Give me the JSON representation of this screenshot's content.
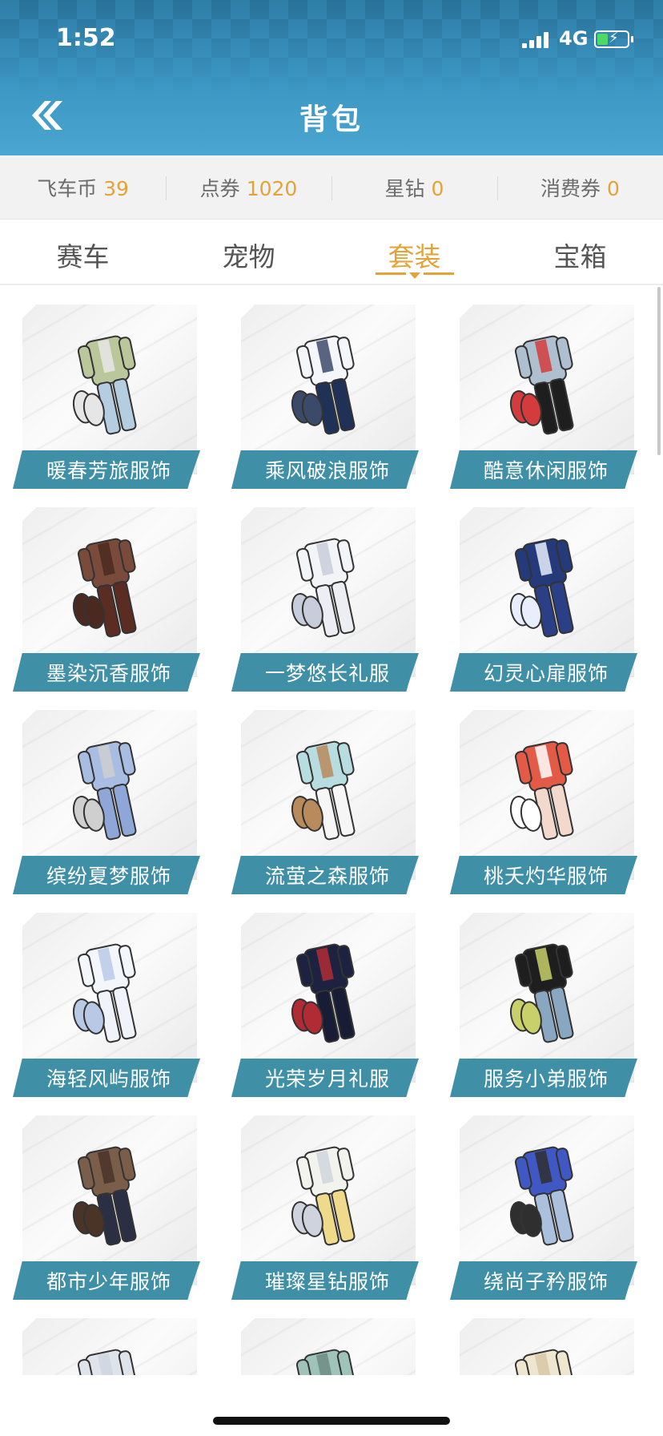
{
  "status_bar": {
    "time": "1:52",
    "network": "4G",
    "icons": [
      "cellular-signal-icon",
      "battery-charging-icon"
    ]
  },
  "header": {
    "title": "背包",
    "back_icon": "double-chevron-left-icon"
  },
  "currency": [
    {
      "label": "飞车币",
      "value": "39"
    },
    {
      "label": "点券",
      "value": "1020"
    },
    {
      "label": "星钻",
      "value": "0"
    },
    {
      "label": "消费券",
      "value": "0"
    }
  ],
  "tabs": [
    {
      "label": "赛车",
      "active": false
    },
    {
      "label": "宠物",
      "active": false
    },
    {
      "label": "套装",
      "active": true
    },
    {
      "label": "宝箱",
      "active": false
    }
  ],
  "colors": {
    "accent": "#e3a33a",
    "header": "#3c97c3",
    "label_bg": "#3f8fa6"
  },
  "items": [
    {
      "name": "暖春芳旅服饰",
      "top": "#b9c79a",
      "bottom": "#b4cde0",
      "accent": "#e6e6e6"
    },
    {
      "name": "乘风破浪服饰",
      "top": "#f4f6fa",
      "bottom": "#1f3157",
      "accent": "#3c4a6a"
    },
    {
      "name": "酷意休闲服饰",
      "top": "#aebfd0",
      "bottom": "#1e1e1e",
      "accent": "#d33c3c"
    },
    {
      "name": "墨染沉香服饰",
      "top": "#7a4a3a",
      "bottom": "#5a2c22",
      "accent": "#4a2a20"
    },
    {
      "name": "一梦悠长礼服",
      "top": "#f3f4f7",
      "bottom": "#eceef3",
      "accent": "#c7cdda"
    },
    {
      "name": "幻灵心扉服饰",
      "top": "#243a7a",
      "bottom": "#2a3f86",
      "accent": "#e8eefb"
    },
    {
      "name": "缤纷夏梦服饰",
      "top": "#a9bde3",
      "bottom": "#8ea7d8",
      "accent": "#cfcfcf"
    },
    {
      "name": "流萤之森服饰",
      "top": "#b8dde0",
      "bottom": "#f6f6f6",
      "accent": "#b98a5c"
    },
    {
      "name": "桃夭灼华服饰",
      "top": "#e35b46",
      "bottom": "#f3d8cc",
      "accent": "#ffffff"
    },
    {
      "name": "海轻风屿服饰",
      "top": "#f3f6fb",
      "bottom": "#f0f3f9",
      "accent": "#b8c9e6"
    },
    {
      "name": "光荣岁月礼服",
      "top": "#1c2240",
      "bottom": "#181c34",
      "accent": "#b02b34"
    },
    {
      "name": "服务小弟服饰",
      "top": "#1e1e1e",
      "bottom": "#8aa7c2",
      "accent": "#c8d06a"
    },
    {
      "name": "都市少年服饰",
      "top": "#7a5e4a",
      "bottom": "#2a2f44",
      "accent": "#4a3428"
    },
    {
      "name": "璀璨星钻服饰",
      "top": "#f3f3ee",
      "bottom": "#efd98a",
      "accent": "#cfd3dd"
    },
    {
      "name": "绕尚子矜服饰",
      "top": "#3f58c4",
      "bottom": "#aac0dc",
      "accent": "#2f2f2f"
    },
    {
      "name": "",
      "top": "#dfe3ea",
      "bottom": "#e6e9ef",
      "accent": "#cfd6e0"
    },
    {
      "name": "",
      "top": "#9fc3b8",
      "bottom": "#c8d7d2",
      "accent": "#6f8c84"
    },
    {
      "name": "",
      "top": "#efe6cf",
      "bottom": "#e8e2d4",
      "accent": "#d6c7a6"
    }
  ]
}
